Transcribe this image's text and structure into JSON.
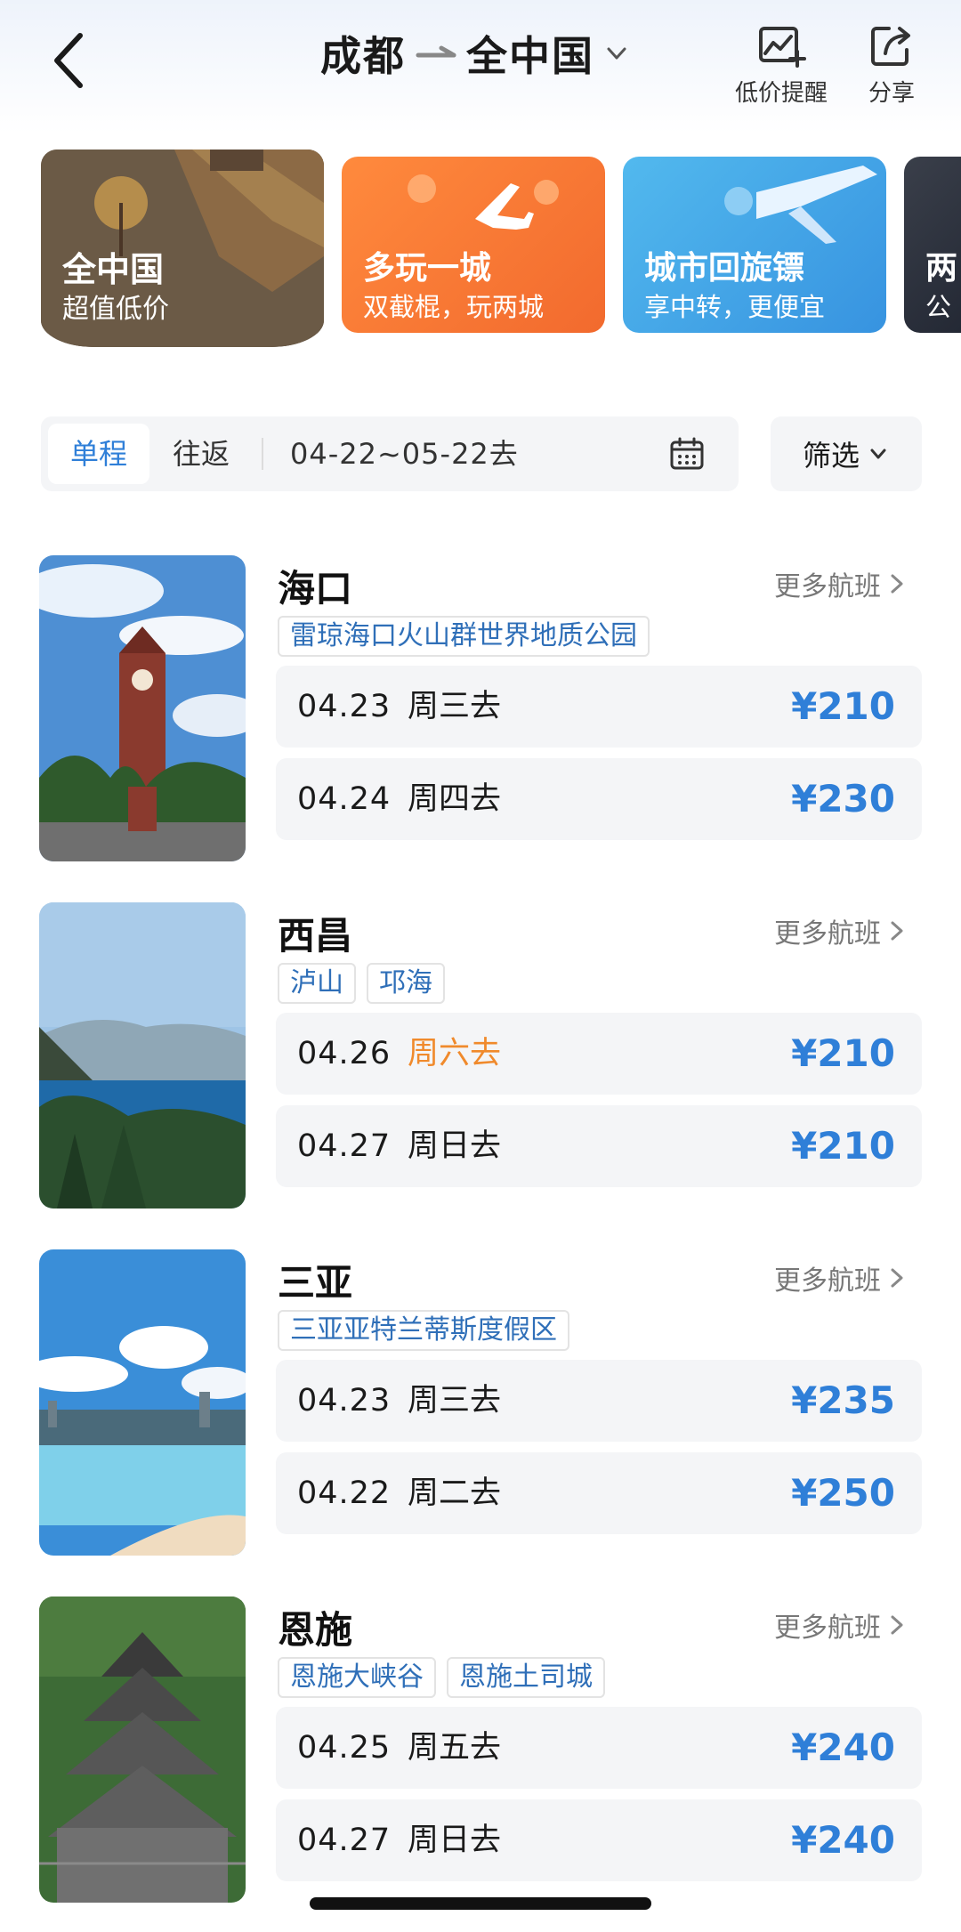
{
  "header": {
    "origin": "成都",
    "destination": "全中国",
    "price_alert_label": "低价提醒",
    "share_label": "分享"
  },
  "promos": [
    {
      "title": "全中国",
      "subtitle": "超值低价"
    },
    {
      "title": "多玩一城",
      "subtitle": "双截棍，玩两城"
    },
    {
      "title": "城市回旋镖",
      "subtitle": "享中转，更便宜"
    },
    {
      "title": "两",
      "subtitle": "公"
    }
  ],
  "filter": {
    "one_way": "单程",
    "round_trip": "往返",
    "date_range": "04-22~05-22去",
    "screen_label": "筛选"
  },
  "destinations": [
    {
      "name": "海口",
      "more": "更多航班",
      "tags": [
        "雷琼海口火山群世界地质公园"
      ],
      "flights": [
        {
          "date": "04.23",
          "day": "周三去",
          "price": "¥210"
        },
        {
          "date": "04.24",
          "day": "周四去",
          "price": "¥230"
        }
      ]
    },
    {
      "name": "西昌",
      "more": "更多航班",
      "tags": [
        "泸山",
        "邛海"
      ],
      "flights": [
        {
          "date": "04.26",
          "day": "周六去",
          "price": "¥210"
        },
        {
          "date": "04.27",
          "day": "周日去",
          "price": "¥210"
        }
      ]
    },
    {
      "name": "三亚",
      "more": "更多航班",
      "tags": [
        "三亚亚特兰蒂斯度假区"
      ],
      "flights": [
        {
          "date": "04.23",
          "day": "周三去",
          "price": "¥235"
        },
        {
          "date": "04.22",
          "day": "周二去",
          "price": "¥250"
        }
      ]
    },
    {
      "name": "恩施",
      "more": "更多航班",
      "tags": [
        "恩施大峡谷",
        "恩施土司城"
      ],
      "flights": [
        {
          "date": "04.25",
          "day": "周五去",
          "price": "¥240"
        },
        {
          "date": "04.27",
          "day": "周日去",
          "price": "¥240"
        }
      ]
    }
  ],
  "colors": {
    "accent_blue": "#2f7fd8",
    "weekend_orange": "#f08a2c",
    "card_bg": "#f4f5f7"
  }
}
